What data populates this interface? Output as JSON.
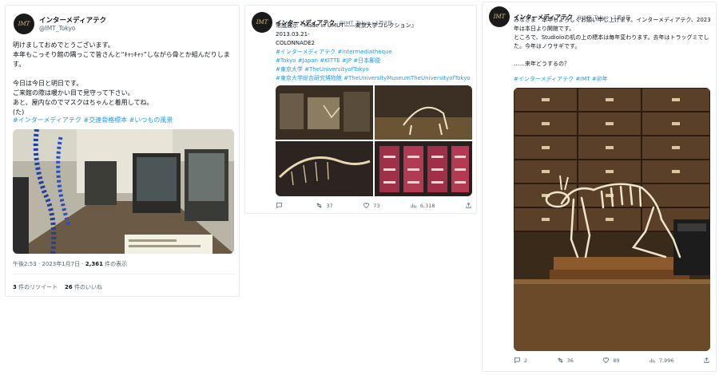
{
  "tweet1": {
    "name": "インターメディアテク",
    "handle": "@IMT_Tokyo",
    "avatar_text": "IMT",
    "body": "明けましておめでとうございます。\n本年もこっそり館の隅っこで皆さんと“ｷｬｯｷｬｯ”しながら骨とか組んだりします。\n\n今日は今日と明日です。\nご来館の際は暖かい目で見守って下さい。\nあと、屋内なのでマスクはちゃんと着用してね。\n(た)",
    "hashtags": "#インターメディアテク #交連骨格標本 #いつもの風景",
    "time": "午後2:53 · 2023年1月7日 · ",
    "views_count": "2,361",
    "views_label": " 件の表示",
    "retweets_count": "3",
    "retweets_label": " 件のリツイート",
    "likes_count": "26",
    "likes_label": " 件のいいね"
  },
  "tweet2": {
    "name": "インターメディアテク",
    "handle": "@IMT_Tokyo · 1月3日",
    "avatar_text": "IMT",
    "line1": "常設展示『Made in UMUT——東京大学コレクション』",
    "line2": "2013.03.21-",
    "line3": "COLONNADE2",
    "hashtags": "#インターメディアテク #intermediatheque\n#Tokyo #Japan #KITTE #JP #日本郵便\n#東京大学 #TheUniversityofTokyo\n#東京大学総合研究博物館 #TheUniversityMuseumTheUniversityofTokyo",
    "replies": "",
    "retweets": "37",
    "likes": "73",
    "views": "6,318"
  },
  "tweet3": {
    "name": "インターメディアテク",
    "handle": "@IMT_Tokyo · 1月4日",
    "avatar_text": "IMT",
    "body": "みなさま　本年もよろしくお願い申し上げます。インターメディアテク、2023年は本日より開館です。\nところで、Studioloの机の上の標本は毎年変わります。去年はトラッグミでした。今年はノウサギです。\n\n……来年どうするの？",
    "hashtags": "#インターメディアテク #IMT #卯年",
    "replies": "2",
    "retweets": "36",
    "likes": "89",
    "views": "7,996"
  },
  "colors": {
    "link": "#1d9bf0",
    "muted": "#536471",
    "text": "#0f1419"
  }
}
